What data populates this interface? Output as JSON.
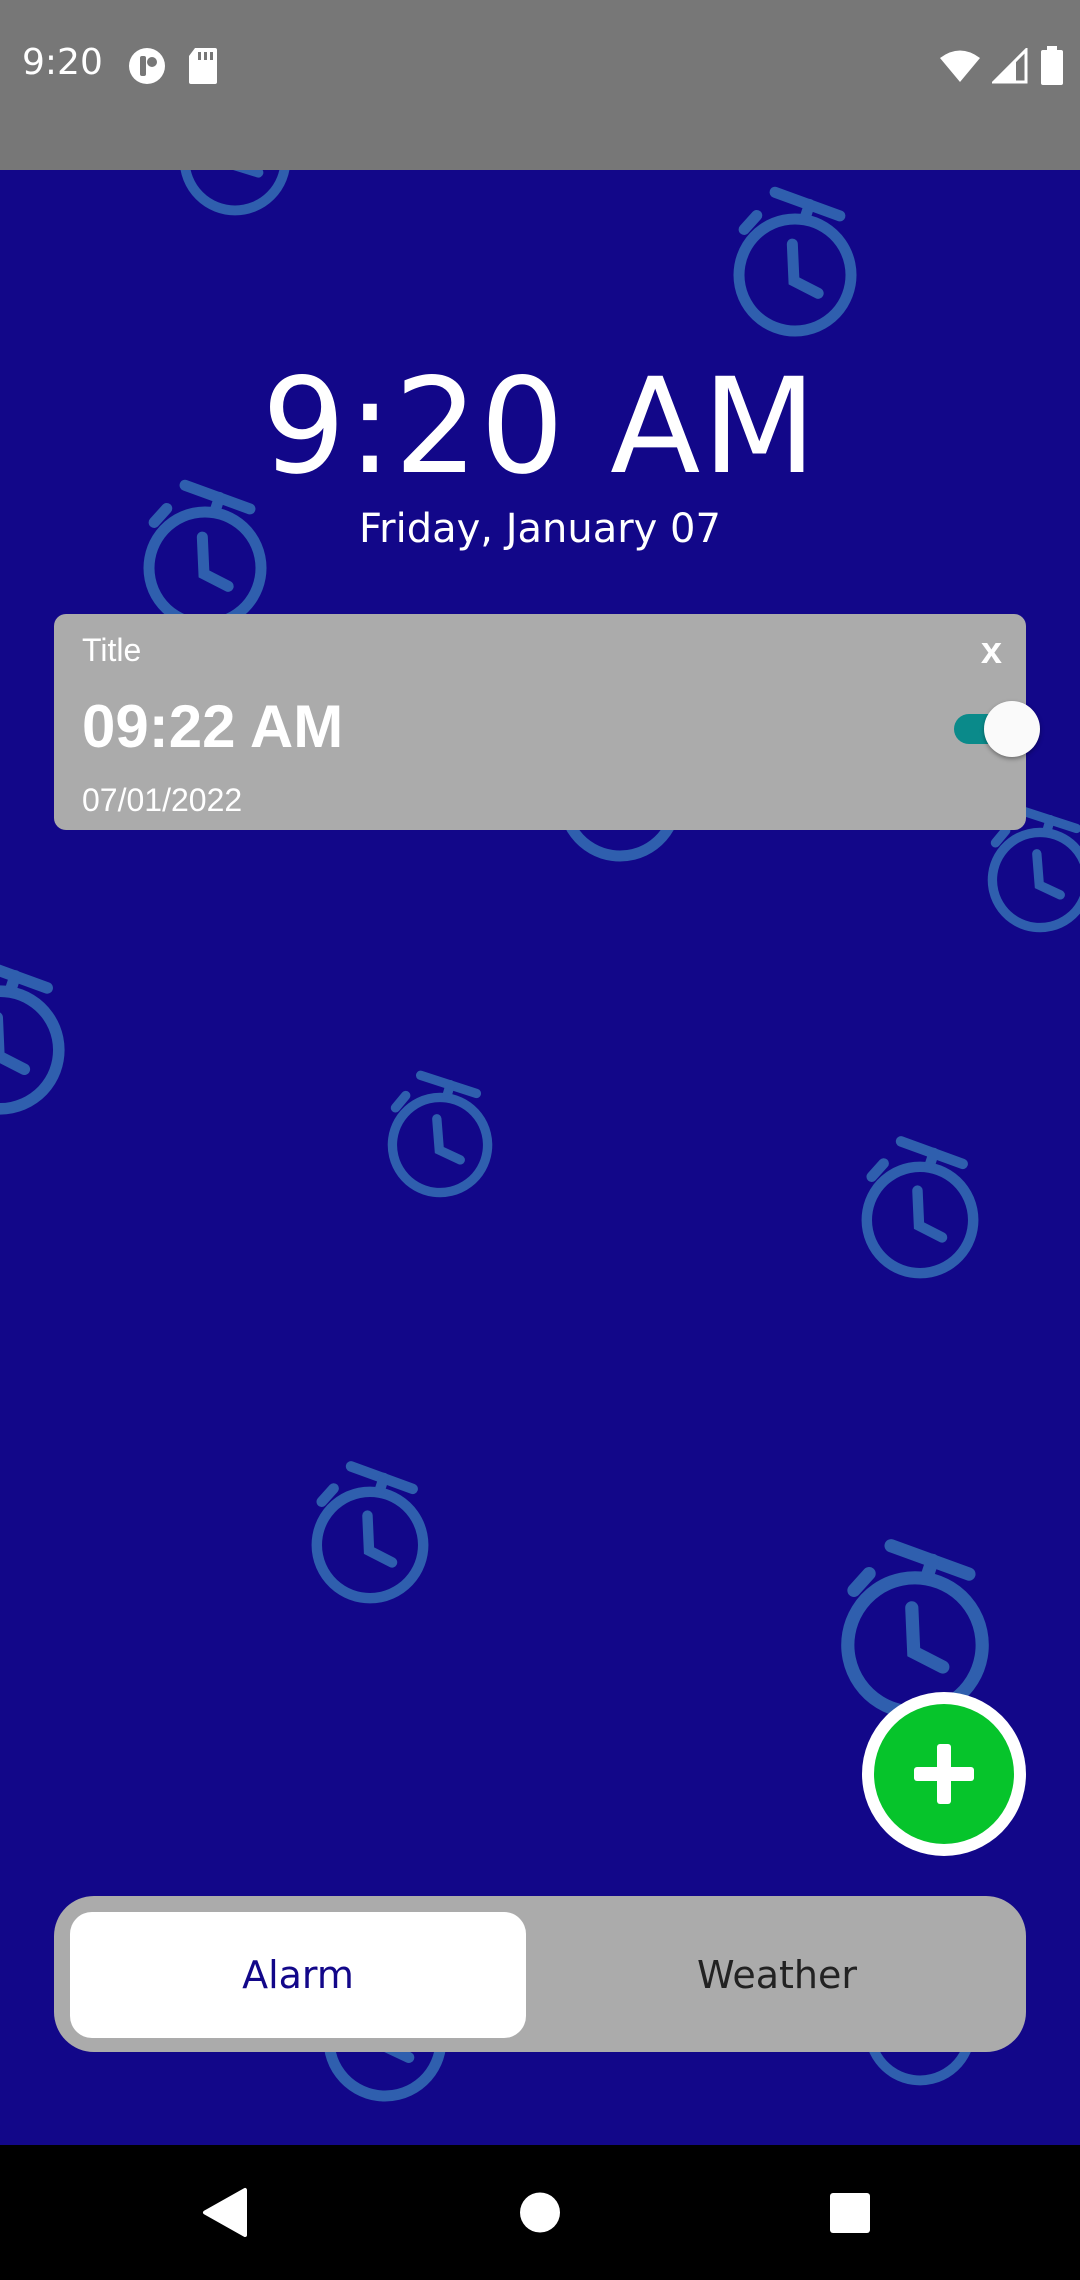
{
  "status_bar": {
    "time": "9:20",
    "icons_left": [
      "sync-icon",
      "sd-card-icon"
    ],
    "icons_right": [
      "wifi-icon",
      "signal-icon",
      "battery-icon"
    ]
  },
  "clock": {
    "time": "9:20 AM",
    "date": "Friday, January 07"
  },
  "alarm": {
    "title": "Title",
    "time": "09:22 AM",
    "date": "07/01/2022",
    "close_label": "x",
    "enabled": true
  },
  "fab": {
    "icon": "plus-icon"
  },
  "tabs": [
    {
      "label": "Alarm",
      "selected": true
    },
    {
      "label": "Weather",
      "selected": false
    }
  ],
  "nav": {
    "icons": [
      "back-icon",
      "home-icon",
      "recents-icon"
    ]
  },
  "colors": {
    "background": "#120789",
    "card": "#ababab",
    "accent_green": "#06c42b",
    "toggle_track": "#0a8a8a",
    "pattern": "#2f5fae"
  }
}
